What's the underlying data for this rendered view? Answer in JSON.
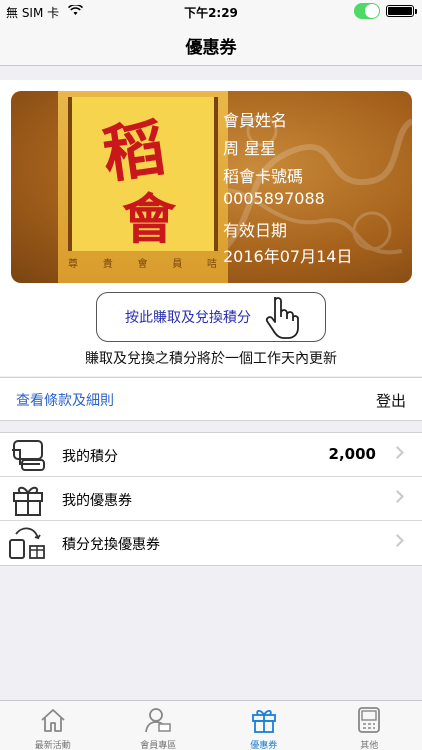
{
  "status_bar": {
    "carrier": "無 SIM 卡",
    "time": "下午2:29"
  },
  "nav": {
    "title": "優惠券"
  },
  "card": {
    "logo_text_1": "稻",
    "logo_text_2": "會",
    "member_strip": [
      "尊",
      "貴",
      "會",
      "員",
      "咭"
    ],
    "member_name_label": "會員姓名",
    "member_name": "周 星星",
    "card_number_label": "稻會卡號碼",
    "card_number": "0005897088",
    "expiry_label": "有效日期",
    "expiry_date": "2016年07月14日"
  },
  "earn_button": {
    "label": "按此賺取及兌換積分"
  },
  "note": "賺取及兌換之積分將於一個工作天內更新",
  "links": {
    "terms": "查看條款及細則",
    "logout": "登出"
  },
  "menu": [
    {
      "label": "我的積分",
      "value": "2,000",
      "icon": "points-card-icon"
    },
    {
      "label": "我的優惠券",
      "value": "",
      "icon": "gift-box-icon"
    },
    {
      "label": "積分兌換優惠券",
      "value": "",
      "icon": "exchange-icon"
    }
  ],
  "tabs": [
    {
      "label": "最新活動",
      "icon": "home-icon",
      "active": false
    },
    {
      "label": "會員專區",
      "icon": "member-icon",
      "active": false
    },
    {
      "label": "優惠券",
      "icon": "gift-icon",
      "active": true
    },
    {
      "label": "其他",
      "icon": "more-icon",
      "active": false
    }
  ],
  "colors": {
    "accent": "#1a7fdc",
    "link": "#2a62c9",
    "card_brown": "#a6621c",
    "logo_red": "#c8181c"
  }
}
